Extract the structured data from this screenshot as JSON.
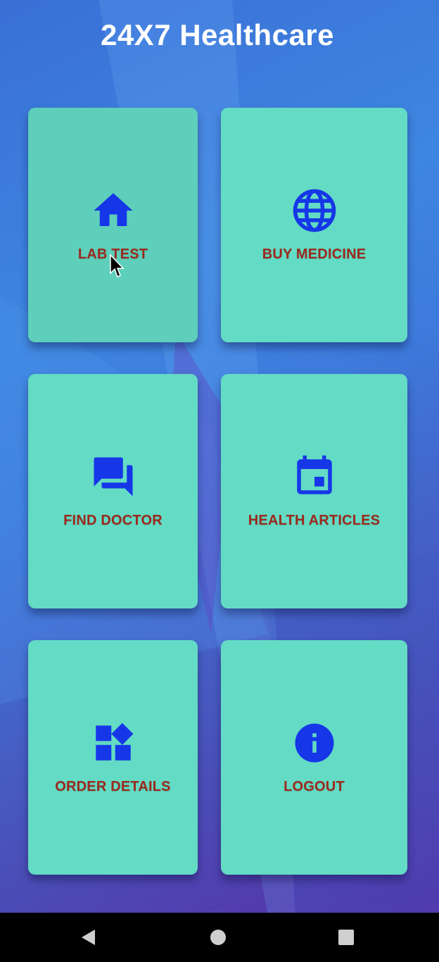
{
  "app": {
    "title": "24X7 Healthcare"
  },
  "colors": {
    "card_background": "#64dbc4",
    "label": "#9b2a1e",
    "icon": "#1637e8",
    "title": "#ffffff",
    "nav_bar": "#000000"
  },
  "menu": {
    "items": [
      {
        "label": "LAB TEST",
        "icon": "home-icon"
      },
      {
        "label": "BUY MEDICINE",
        "icon": "globe-icon"
      },
      {
        "label": "FIND DOCTOR",
        "icon": "chat-icon"
      },
      {
        "label": "HEALTH ARTICLES",
        "icon": "calendar-icon"
      },
      {
        "label": "ORDER DETAILS",
        "icon": "widgets-icon"
      },
      {
        "label": "LOGOUT",
        "icon": "info-icon"
      }
    ]
  },
  "nav": {
    "back": "back-icon",
    "home": "home-circle-icon",
    "recents": "recents-square-icon"
  }
}
